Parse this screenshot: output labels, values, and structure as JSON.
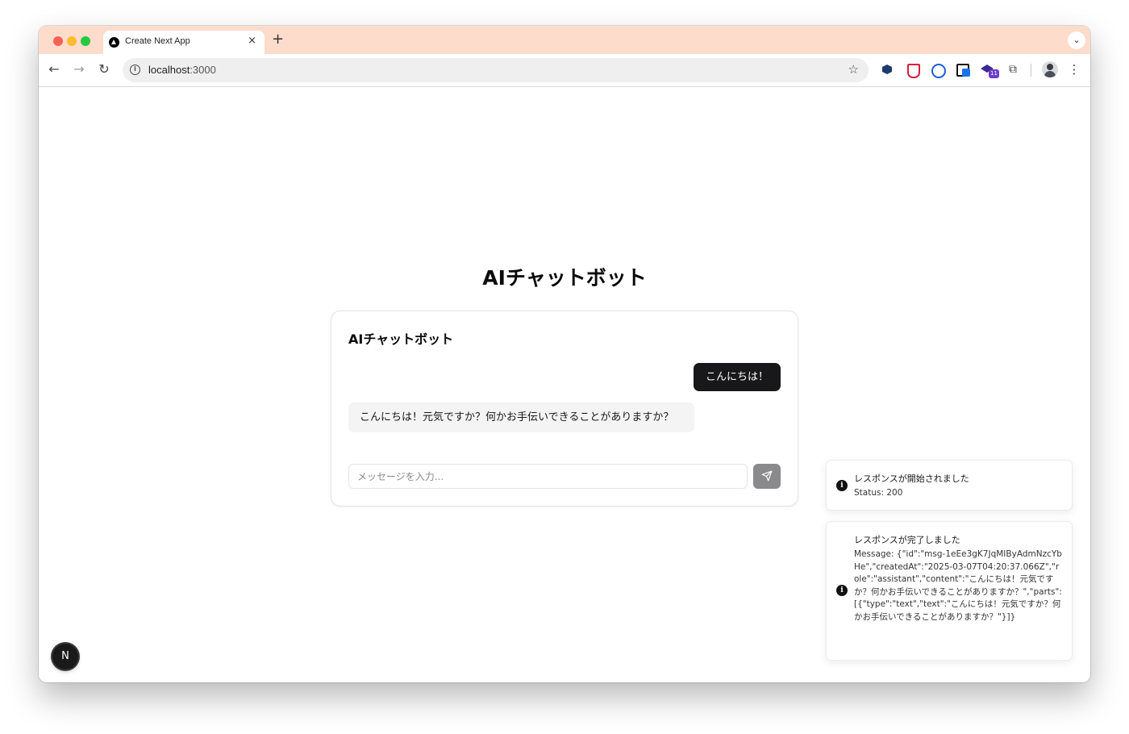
{
  "browser": {
    "tab": {
      "title": "Create Next App",
      "close_icon": "×"
    },
    "new_tab_icon": "+",
    "tab_search_icon": "⌄",
    "nav": {
      "back_icon": "←",
      "forward_icon": "→",
      "reload_icon": "↻"
    },
    "omnibox": {
      "host": "localhost",
      "port": ":3000",
      "info_icon": "i",
      "star_icon": "☆"
    },
    "extensions": {
      "badge_count": "11",
      "puzzle_icon": "⧉"
    },
    "menu_icon": "⋮"
  },
  "page": {
    "title": "AIチャットボット",
    "chat": {
      "title": "AIチャットボット",
      "messages": [
        {
          "role": "user",
          "text": "こんにちは！"
        },
        {
          "role": "assistant",
          "text": "こんにちは！元気ですか？何かお手伝いできることがありますか？"
        }
      ],
      "input": {
        "placeholder": "メッセージを入力...",
        "value": ""
      }
    },
    "toasts": [
      {
        "icon": "i",
        "title": "レスポンスが開始されました",
        "description": "Status: 200"
      },
      {
        "icon": "i",
        "title": "レスポンスが完了しました",
        "description": "Message: {\"id\":\"msg-1eEe3gK7JqMIByAdmNzcYbHe\",\"createdAt\":\"2025-03-07T04:20:37.066Z\",\"role\":\"assistant\",\"content\":\"こんにちは！元気ですか？何かお手伝いできることがありますか？\",\"parts\":[{\"type\":\"text\",\"text\":\"こんにちは！元気ですか？何かお手伝いできることがありますか？\"}]}"
      }
    ],
    "next_badge": "N"
  },
  "colors": {
    "tab_strip": "#fddccb",
    "user_bubble": "#18181b",
    "assistant_bubble": "#f4f4f5",
    "send_button": "#8a8a8c"
  }
}
